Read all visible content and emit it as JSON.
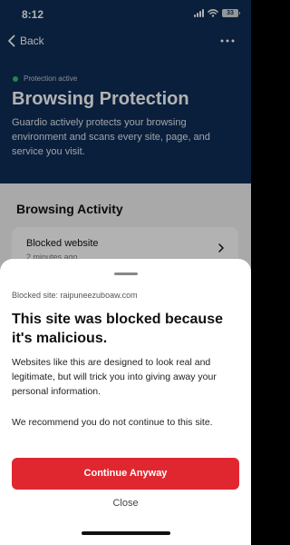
{
  "status_bar": {
    "time": "8:12",
    "battery": "33",
    "icons": [
      "signal-icon",
      "wifi-icon",
      "battery-icon"
    ]
  },
  "nav": {
    "back_label": "Back",
    "back_icon": "chevron-left-icon",
    "more_icon": "more-horizontal-icon"
  },
  "hero": {
    "status": "Protection active",
    "title": "Browsing Protection",
    "description": "Guardio actively protects your browsing environment and scans every site, page, and service you visit."
  },
  "activity": {
    "title": "Browsing Activity",
    "items": [
      {
        "label": "Blocked website",
        "time": "2 minutes ago"
      }
    ]
  },
  "sheet": {
    "blocked_site": "Blocked site: raipuneezuboaw.com",
    "title": "This site was blocked because it's malicious.",
    "paragraph1": "Websites like this are designed to look real and legitimate, but will trick you into giving away your personal information.",
    "paragraph2": "We recommend you do not continue to this site.",
    "continue_label": "Continue Anyway",
    "close_label": "Close"
  },
  "colors": {
    "header_bg": "#0e2d57",
    "accent_red": "#e02730",
    "active_green": "#27c46a"
  }
}
